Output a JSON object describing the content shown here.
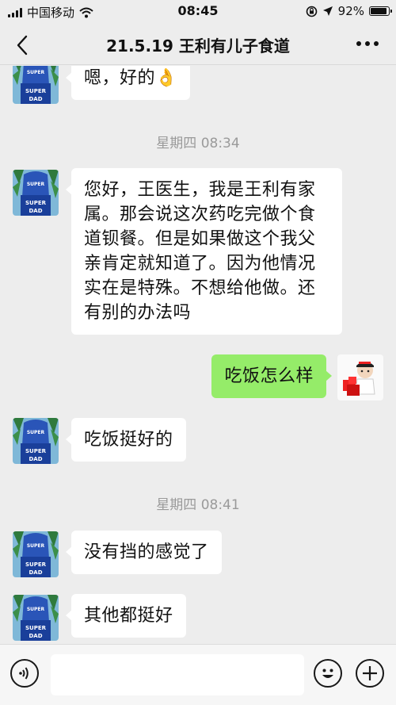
{
  "status_bar": {
    "carrier": "中国移动",
    "time": "08:45",
    "battery": "92%",
    "battery_level": 0.92
  },
  "nav": {
    "title": "21.5.19 王利有儿子食道"
  },
  "messages": [
    {
      "side": "left",
      "text": "嗯，好的👌"
    },
    {
      "timestamp": "星期四 08:34"
    },
    {
      "side": "left",
      "text": "您好，王医生，我是王利有家属。那会说这次药吃完做个食道钡餐。但是如果做这个我父亲肯定就知道了。因为他情况实在是特殊。不想给他做。还有别的办法吗"
    },
    {
      "side": "right",
      "text": "吃饭怎么样"
    },
    {
      "side": "left",
      "text": "吃饭挺好的"
    },
    {
      "timestamp": "星期四 08:41"
    },
    {
      "side": "left",
      "text": "没有挡的感觉了"
    },
    {
      "side": "left",
      "text": "其他都挺好"
    }
  ],
  "avatar_contact": {
    "line1": "SUPER",
    "line2": "SUPER",
    "line3": "DAD"
  },
  "colors": {
    "background": "#ededed",
    "bubble_self": "#95ec69",
    "bubble_other": "#ffffff",
    "timestamp": "#9a9a9a"
  },
  "icons": {
    "back": "chevron-left-icon",
    "more": "more-dots-icon",
    "voice": "voice-icon",
    "emoji": "emoji-icon",
    "plus": "plus-icon"
  }
}
